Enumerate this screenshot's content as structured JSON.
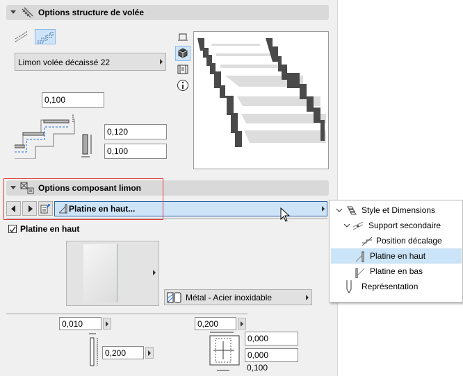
{
  "section1": {
    "title": "Options structure de volée",
    "profile_select": "Limon volée décaissé 22",
    "top_offset": "0,100",
    "height": "0,120",
    "width": "0,100"
  },
  "section2": {
    "title": "Options composant limon",
    "page_select": "Platine en haut...",
    "checkbox_label": "Platine en haut",
    "checkbox_checked": true,
    "material": "Métal - Acier inoxidable",
    "thickness": "0,010",
    "plate_width": "0,200",
    "plate_height": "0,200",
    "offset_x": "0,000",
    "offset_y": "0,000",
    "offset_bottom": "0,100"
  },
  "menu": {
    "items": [
      {
        "label": "Style et Dimensions",
        "level": 0,
        "expanded": true
      },
      {
        "label": "Support secondaire",
        "level": 1,
        "expanded": true
      },
      {
        "label": "Position décalage",
        "level": 2
      },
      {
        "label": "Platine en haut",
        "level": 1,
        "selected": true
      },
      {
        "label": "Platine en bas",
        "level": 1
      },
      {
        "label": "Représentation",
        "level": 0
      }
    ]
  },
  "colors": {
    "highlight": "#cce4f7",
    "annotation": "#e53935",
    "selected_field": "#cde3f7"
  }
}
